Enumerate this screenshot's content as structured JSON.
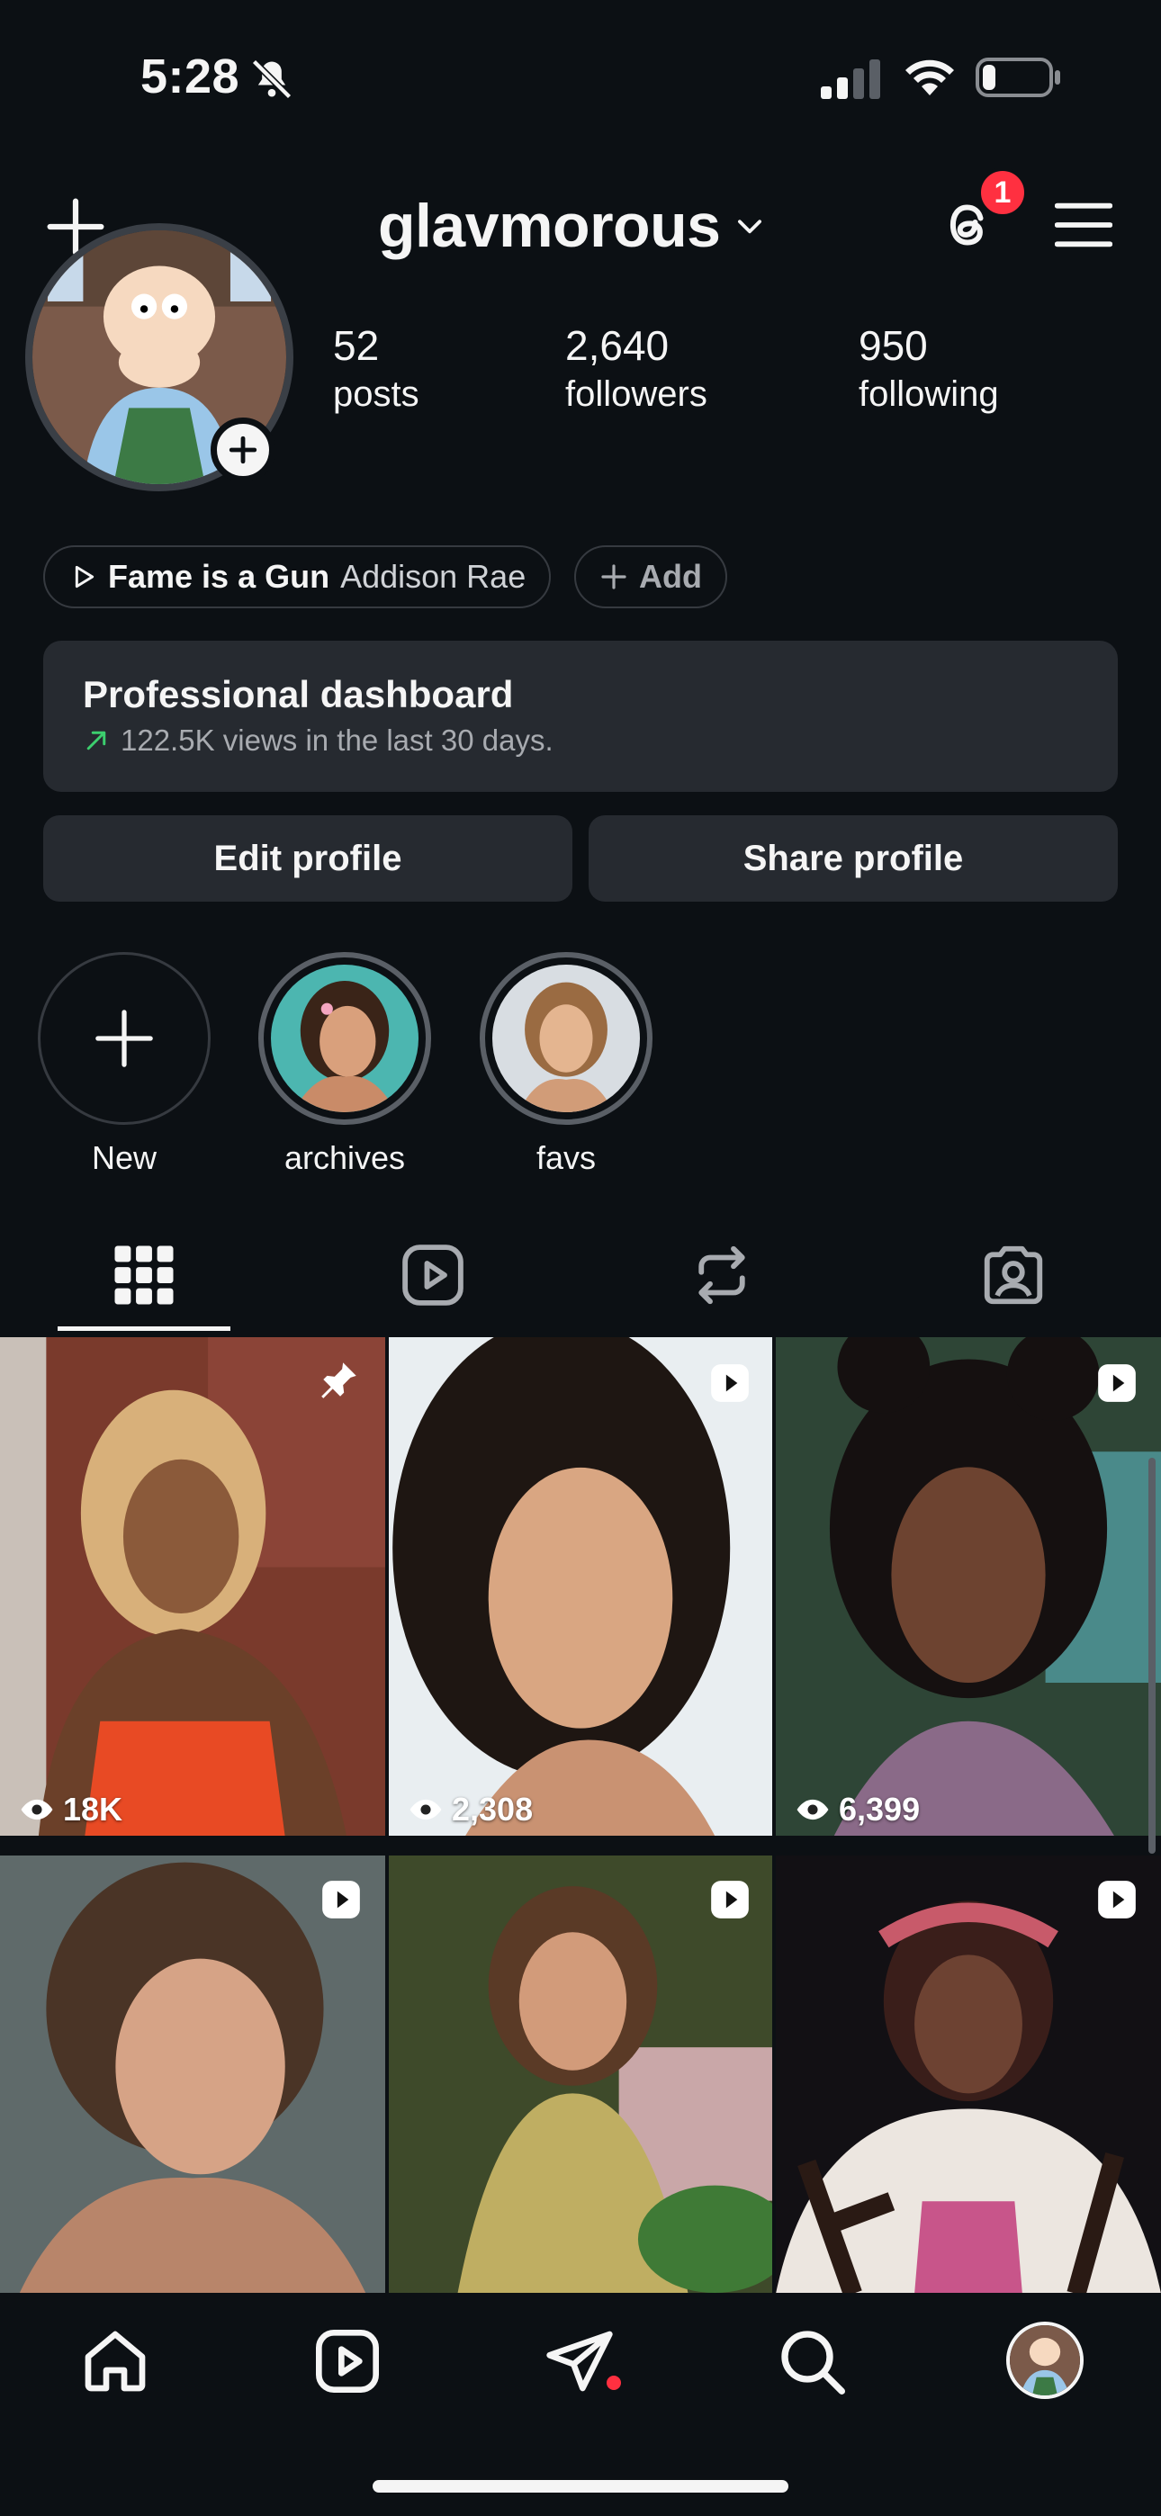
{
  "status_bar": {
    "time": "5:28"
  },
  "header": {
    "username": "glavmorous",
    "threads_badge": "1"
  },
  "profile": {
    "stats": [
      {
        "value": "52",
        "label": "posts"
      },
      {
        "value": "2,640",
        "label": "followers"
      },
      {
        "value": "950",
        "label": "following"
      }
    ],
    "music": {
      "song": "Fame is a Gun",
      "artist": "Addison Rae"
    },
    "add_label": "Add"
  },
  "dashboard": {
    "title": "Professional dashboard",
    "subtitle": "122.5K views in the last 30 days."
  },
  "buttons": {
    "edit": "Edit profile",
    "share": "Share profile"
  },
  "highlights": [
    {
      "label": "New"
    },
    {
      "label": "archives"
    },
    {
      "label": "favs"
    }
  ],
  "tabs": [
    "posts-grid",
    "reels",
    "reposts",
    "tagged"
  ],
  "grid": [
    {
      "views": "18K",
      "badge": "pin"
    },
    {
      "views": "2,308",
      "badge": "reel"
    },
    {
      "views": "6,399",
      "badge": "reel"
    },
    {
      "views": "",
      "badge": "reel"
    },
    {
      "views": "",
      "badge": "reel"
    },
    {
      "views": "",
      "badge": "reel"
    }
  ],
  "colors": {
    "background": "#0c1014",
    "surface": "#262a30",
    "notification": "#ff3040",
    "trend_up": "#3ccf6e"
  }
}
